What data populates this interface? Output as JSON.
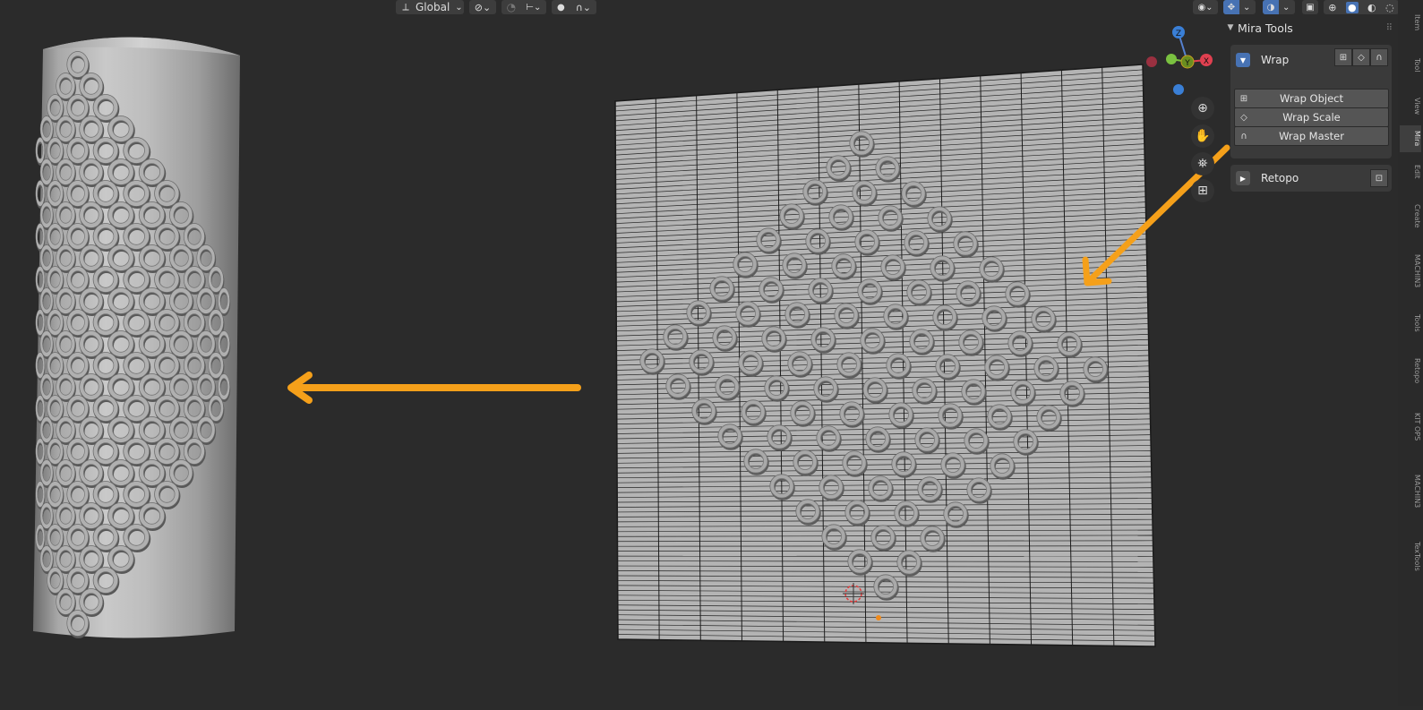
{
  "header": {
    "transform_orientation": "Global",
    "transform_dropdown_arrow": "⌄"
  },
  "gizmo": {
    "z_label": "Z",
    "x_label": "X",
    "y_label": "Y"
  },
  "sidebar": {
    "panel_title": "Mira Tools",
    "wrap": {
      "label": "Wrap",
      "buttons": [
        "Wrap Object",
        "Wrap Scale",
        "Wrap Master"
      ]
    },
    "retopo": {
      "label": "Retopo"
    },
    "tabs": [
      "Item",
      "Tool",
      "View",
      "Mira",
      "Edit",
      "Create",
      "MACHIN3",
      "Tools",
      "Retopo",
      "KIT OPS",
      "MACHIN3",
      "TexTools"
    ]
  },
  "colors": {
    "arrow": "#f5a01a",
    "viewport_bg": "#2b2b2b",
    "mesh_fill": "#b2b2b2",
    "mesh_wire": "#1a1a1a",
    "accent_blue": "#4772b3"
  },
  "icons": [
    "transform-orientation-icon",
    "snap-icon",
    "proportional-icon",
    "zoom-icon",
    "hand-pan-icon",
    "camera-icon",
    "grid-icon",
    "wireframe-shading-icon",
    "solid-shading-icon",
    "material-shading-icon",
    "rendered-shading-icon"
  ]
}
